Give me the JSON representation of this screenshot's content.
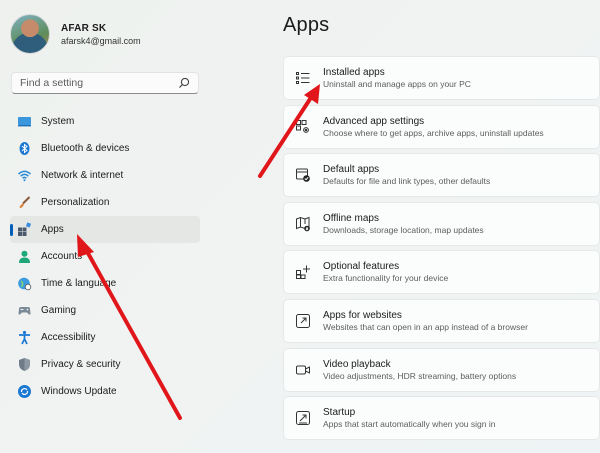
{
  "profile": {
    "name": "AFAR SK",
    "email": "afarsk4@gmail.com"
  },
  "search": {
    "placeholder": "Find a setting"
  },
  "sidebar": {
    "items": [
      {
        "label": "System",
        "icon": "monitor-icon"
      },
      {
        "label": "Bluetooth & devices",
        "icon": "bluetooth-icon"
      },
      {
        "label": "Network & internet",
        "icon": "wifi-icon"
      },
      {
        "label": "Personalization",
        "icon": "brush-icon"
      },
      {
        "label": "Apps",
        "icon": "apps-icon",
        "selected": true
      },
      {
        "label": "Accounts",
        "icon": "person-icon"
      },
      {
        "label": "Time & language",
        "icon": "globe-clock-icon"
      },
      {
        "label": "Gaming",
        "icon": "gamepad-icon"
      },
      {
        "label": "Accessibility",
        "icon": "accessibility-icon"
      },
      {
        "label": "Privacy & security",
        "icon": "shield-icon"
      },
      {
        "label": "Windows Update",
        "icon": "update-icon"
      }
    ]
  },
  "main": {
    "title": "Apps",
    "cards": [
      {
        "title": "Installed apps",
        "desc": "Uninstall and manage apps on your PC",
        "icon": "list-icon"
      },
      {
        "title": "Advanced app settings",
        "desc": "Choose where to get apps, archive apps, uninstall updates",
        "icon": "app-gear-icon"
      },
      {
        "title": "Default apps",
        "desc": "Defaults for file and link types, other defaults",
        "icon": "default-apps-icon"
      },
      {
        "title": "Offline maps",
        "desc": "Downloads, storage location, map updates",
        "icon": "map-icon"
      },
      {
        "title": "Optional features",
        "desc": "Extra functionality for your device",
        "icon": "add-grid-icon"
      },
      {
        "title": "Apps for websites",
        "desc": "Websites that can open in an app instead of a browser",
        "icon": "open-link-icon"
      },
      {
        "title": "Video playback",
        "desc": "Video adjustments, HDR streaming, battery options",
        "icon": "video-icon"
      },
      {
        "title": "Startup",
        "desc": "Apps that start automatically when you sign in",
        "icon": "startup-icon"
      }
    ]
  },
  "colors": {
    "accent": "#005fb8",
    "annotation_arrow": "#e0161b"
  }
}
